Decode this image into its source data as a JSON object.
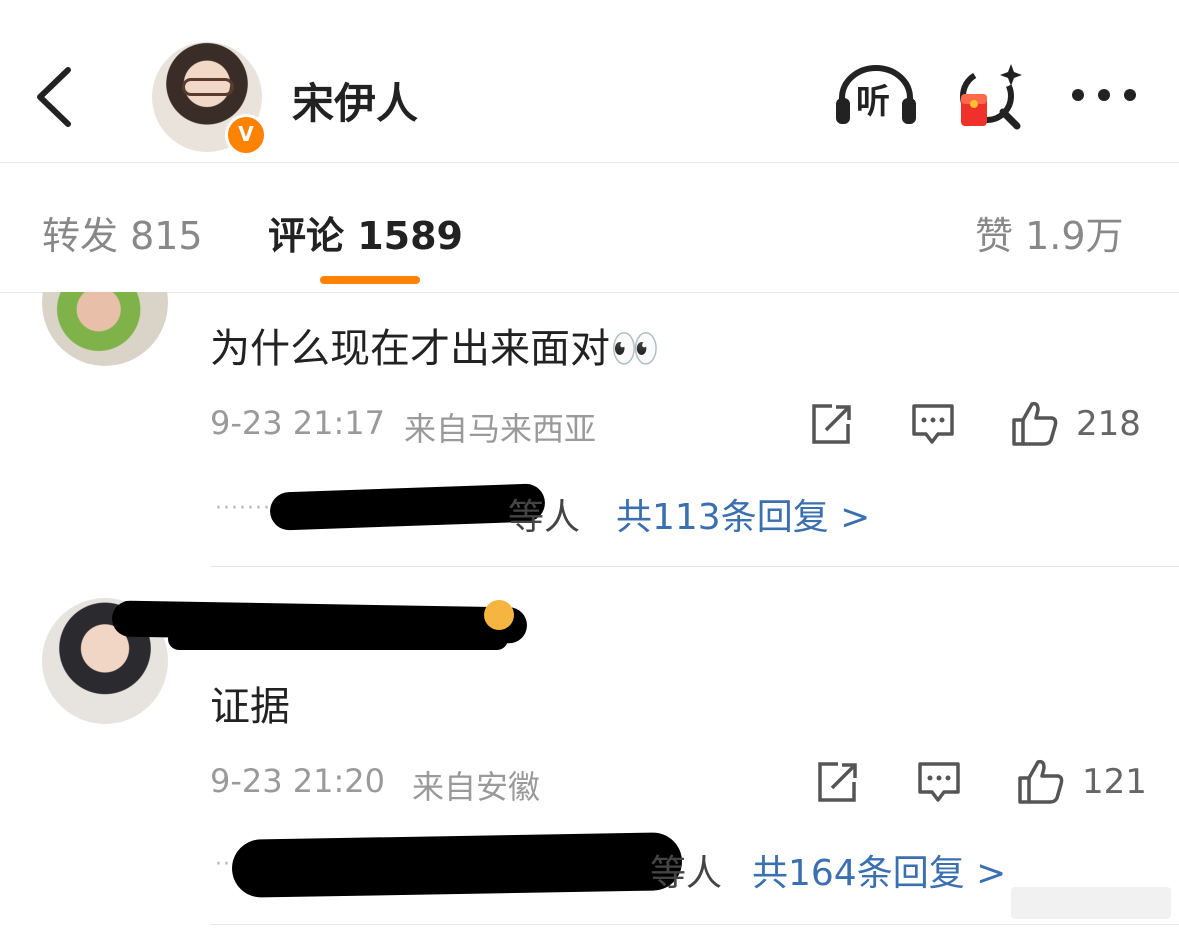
{
  "header": {
    "profile_name": "宋伊人",
    "listen_label": "听",
    "icons": [
      "back-icon",
      "listen-icon",
      "red-packet-search-icon",
      "more-icon",
      "verified-badge-icon"
    ],
    "verified_badge": "V",
    "accent_color": "#ff8200"
  },
  "tabs": [
    {
      "label": "转发 815"
    },
    {
      "label": "评论 1589",
      "active": true
    },
    {
      "label": "赞 1.9万"
    }
  ],
  "comments": [
    {
      "text": "为什么现在才出来面对👀",
      "time": "9-23 21:17",
      "location": "来自马来西亚",
      "likes": "218",
      "reply_suffix": "等人",
      "reply_link": "共113条回复 >"
    },
    {
      "text": "证据",
      "time": "9-23 21:20",
      "location": "来自安徽",
      "likes": "121",
      "reply_suffix": "等人",
      "reply_link": "共164条回复 >"
    }
  ],
  "colors": {
    "link": "#3a6fb0",
    "meta": "#9a9a9a"
  }
}
